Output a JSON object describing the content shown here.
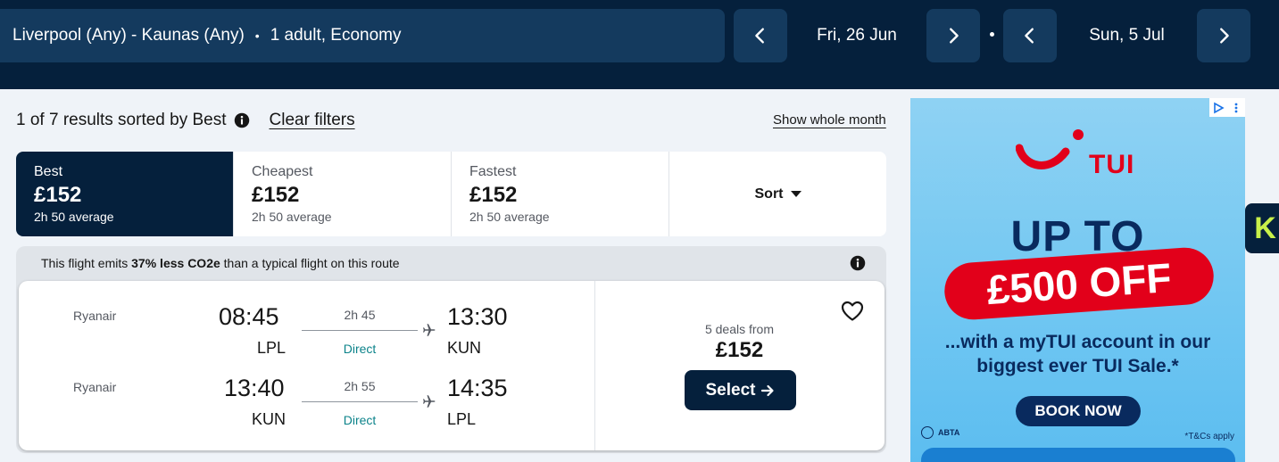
{
  "search": {
    "route": "Liverpool (Any) - Kaunas (Any)",
    "passengers": "1 adult, Economy",
    "depart_date": "Fri, 26 Jun",
    "return_date": "Sun, 5 Jul"
  },
  "results": {
    "summary": "1 of 7 results sorted by Best",
    "clear_filters": "Clear filters",
    "show_whole_month": "Show whole month"
  },
  "tabs": [
    {
      "label": "Best",
      "price": "£152",
      "sub": "2h 50 average"
    },
    {
      "label": "Cheapest",
      "price": "£152",
      "sub": "2h 50 average"
    },
    {
      "label": "Fastest",
      "price": "£152",
      "sub": "2h 50 average"
    }
  ],
  "sort_label": "Sort",
  "eco": {
    "prefix": "This flight emits ",
    "highlight": "37% less CO2e",
    "suffix": " than a typical flight on this route"
  },
  "legs": [
    {
      "airline": "Ryanair",
      "dep_time": "08:45",
      "dep_code": "LPL",
      "duration": "2h 45",
      "stops": "Direct",
      "arr_time": "13:30",
      "arr_code": "KUN"
    },
    {
      "airline": "Ryanair",
      "dep_time": "13:40",
      "dep_code": "KUN",
      "duration": "2h 55",
      "stops": "Direct",
      "arr_time": "14:35",
      "arr_code": "LPL"
    }
  ],
  "deal": {
    "deals_from": "5 deals from",
    "price": "£152",
    "select_label": "Select"
  },
  "ad": {
    "brand": "TUI",
    "headline": "UP TO",
    "offer": "£500 OFF",
    "line1": "...with a myTUI account in our",
    "line2": "biggest ever TUI Sale.*",
    "cta": "BOOK NOW",
    "abta": "ABTA",
    "tcs": "*T&Cs apply",
    "colors": {
      "red": "#e2001a",
      "navy": "#092a5e"
    }
  },
  "badge": {
    "letter": "K"
  },
  "colors": {
    "header": "#05203c",
    "accent_green": "#0c838a"
  }
}
